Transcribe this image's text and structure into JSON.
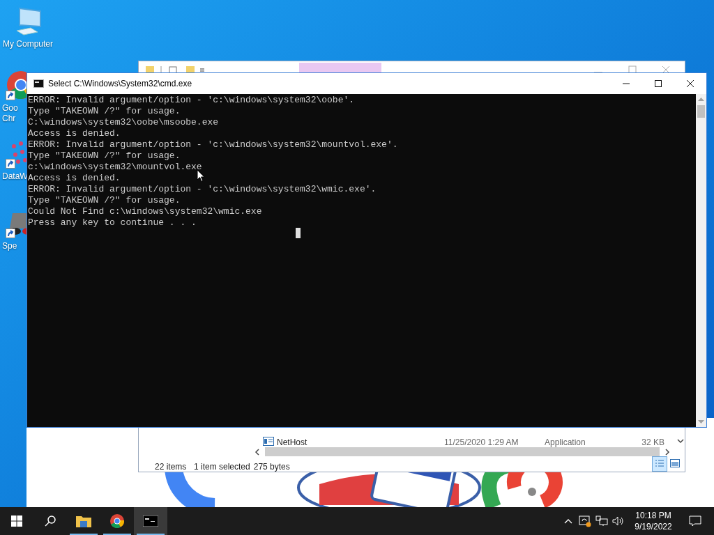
{
  "desktop_icons": [
    {
      "kind": "computer",
      "label": "My Computer"
    },
    {
      "kind": "chrome",
      "label": "Goo\nChr"
    },
    {
      "kind": "grid",
      "label": "DataW"
    },
    {
      "kind": "glasses",
      "label": "Spe"
    }
  ],
  "explorer_window": {
    "row": {
      "name": "NetHost",
      "date": "11/25/2020 1:29 AM",
      "type": "Application",
      "size": "32 KB"
    },
    "status": {
      "items": "22 items",
      "selection": "1 item selected",
      "size": "275 bytes"
    }
  },
  "cmd_window": {
    "title": "Select C:\\Windows\\System32\\cmd.exe",
    "lines": [
      "ERROR: Invalid argument/option - 'c:\\windows\\system32\\oobe'.",
      "Type \"TAKEOWN /?\" for usage.",
      "C:\\windows\\system32\\oobe\\msoobe.exe",
      "Access is denied.",
      "ERROR: Invalid argument/option - 'c:\\windows\\system32\\mountvol.exe'.",
      "Type \"TAKEOWN /?\" for usage.",
      "c:\\windows\\system32\\mountvol.exe",
      "Access is denied.",
      "ERROR: Invalid argument/option - 'c:\\windows\\system32\\wmic.exe'.",
      "Type \"TAKEOWN /?\" for usage.",
      "Could Not Find c:\\windows\\system32\\wmic.exe",
      "Press any key to continue . . ."
    ]
  },
  "taskbar": {
    "buttons": [
      {
        "kind": "start",
        "running": false,
        "selected": false
      },
      {
        "kind": "search",
        "running": false,
        "selected": false
      },
      {
        "kind": "explorer",
        "running": true,
        "selected": false
      },
      {
        "kind": "chrome",
        "running": true,
        "selected": false
      },
      {
        "kind": "cmd",
        "running": true,
        "selected": true
      }
    ],
    "time": "10:18 PM",
    "date": "9/19/2022"
  }
}
